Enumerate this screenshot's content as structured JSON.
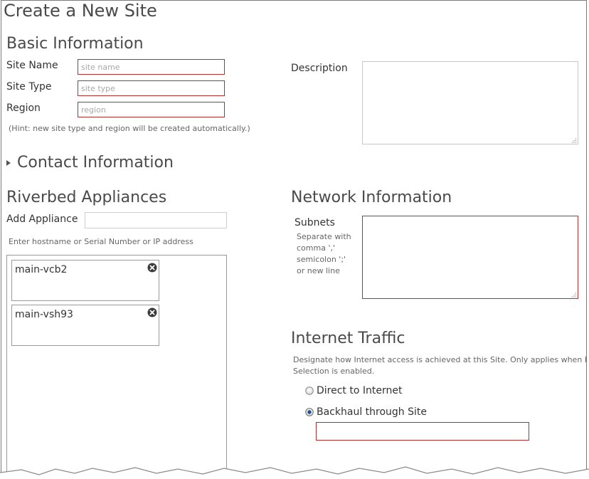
{
  "page": {
    "title": "Create a New Site"
  },
  "basic": {
    "heading": "Basic Information",
    "site_name_label": "Site Name",
    "site_name_placeholder": "site name",
    "site_type_label": "Site Type",
    "site_type_placeholder": "site type",
    "region_label": "Region",
    "region_placeholder": "region",
    "hint": "(Hint: new site type and region will be created automatically.)",
    "description_label": "Description"
  },
  "contact": {
    "heading": "Contact Information",
    "icon": "triangle-right-icon"
  },
  "appliances": {
    "heading": "Riverbed Appliances",
    "add_label": "Add Appliance",
    "add_value": "",
    "hint": "Enter hostname or Serial Number or IP address",
    "items": [
      {
        "name": "main-vcb2",
        "icon": "close-icon"
      },
      {
        "name": "main-vsh93",
        "icon": "close-icon"
      }
    ]
  },
  "network": {
    "heading": "Network Information",
    "subnets_label": "Subnets",
    "subnets_help": [
      "Separate with",
      "comma ','",
      "semicolon ';'",
      "or new line"
    ]
  },
  "internet": {
    "heading": "Internet Traffic",
    "desc_line1": "Designate how Internet access is achieved at this Site. Only applies when Path",
    "desc_line2": "Selection is enabled.",
    "options": [
      {
        "label": "Direct to Internet",
        "selected": false
      },
      {
        "label": "Backhaul through Site",
        "selected": true
      }
    ],
    "backhaul_site_value": ""
  },
  "colors": {
    "error_border": "#b3302c",
    "heading": "#4a4a4a",
    "text": "#333333"
  }
}
